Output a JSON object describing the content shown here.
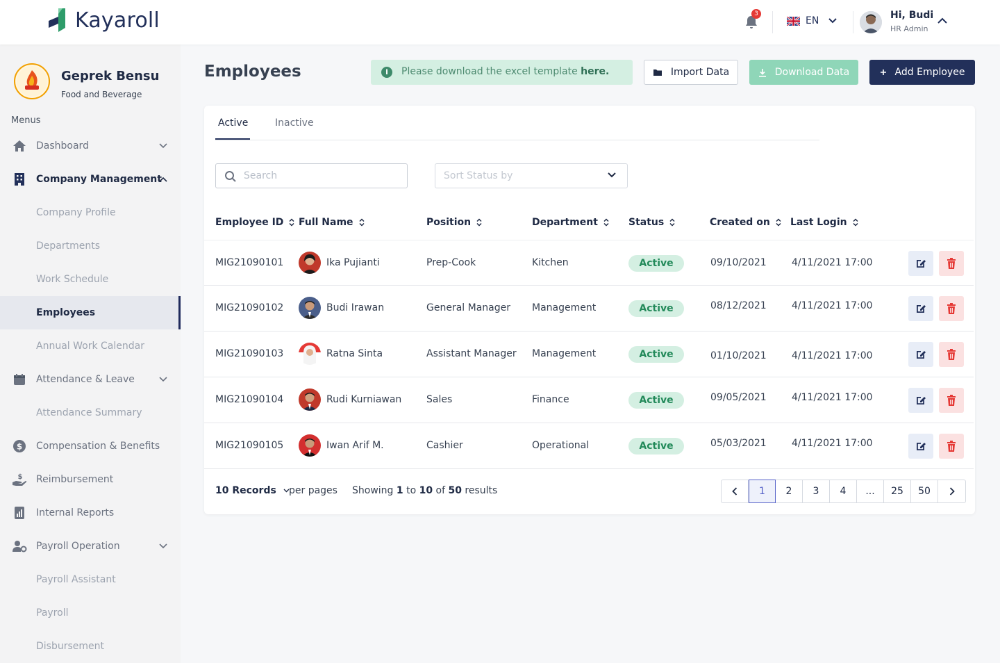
{
  "app": {
    "brand": "Kayaroll"
  },
  "header": {
    "notification_count": "3",
    "language": "EN",
    "user_greeting": "Hi, Budi",
    "user_role": "HR Admin"
  },
  "sidebar": {
    "company_name": "Geprek Bensu",
    "company_type": "Food and Beverage",
    "menus_label": "Menus",
    "items": [
      {
        "label": "Dashboard",
        "icon": "home-icon"
      },
      {
        "label": "Company Management",
        "icon": "building-icon"
      },
      {
        "label": "Company Profile"
      },
      {
        "label": "Departments"
      },
      {
        "label": "Work Schedule"
      },
      {
        "label": "Employees"
      },
      {
        "label": "Annual Work Calendar"
      },
      {
        "label": "Attendance & Leave",
        "icon": "calendar-icon"
      },
      {
        "label": "Attendance Summary"
      },
      {
        "label": "Compensation & Benefits",
        "icon": "dollar-icon"
      },
      {
        "label": "Reimbursement",
        "icon": "hand-money-icon"
      },
      {
        "label": "Internal Reports",
        "icon": "report-icon"
      },
      {
        "label": "Payroll Operation",
        "icon": "user-gear-icon"
      },
      {
        "label": "Payroll Assistant"
      },
      {
        "label": "Payroll"
      },
      {
        "label": "Disbursement"
      }
    ]
  },
  "main": {
    "title": "Employees",
    "banner_text": "Please download the excel template ",
    "banner_link": "here.",
    "import_label": "Import Data",
    "download_label": "Download Data",
    "add_label": "Add Employee",
    "tabs": [
      {
        "label": "Active"
      },
      {
        "label": "Inactive"
      }
    ],
    "search_placeholder": "Search",
    "sort_placeholder": "Sort Status by",
    "columns": [
      "Employee ID",
      "Full Name",
      "Position",
      "Department",
      "Status",
      "Created on",
      "Last Login"
    ],
    "rows": [
      {
        "id": "MIG21090101",
        "name": "Ika Pujianti",
        "position": "Prep-Cook",
        "department": "Kitchen",
        "status": "Active",
        "created": "09/10/2021",
        "last_login": "4/11/2021 17:00"
      },
      {
        "id": "MIG21090102",
        "name": "Budi Irawan",
        "position": "General Manager",
        "department": "Management",
        "status": "Active",
        "created": "08/12/2021",
        "last_login": "4/11/2021 17:00"
      },
      {
        "id": "MIG21090103",
        "name": "Ratna Sinta",
        "position": "Assistant Manager",
        "department": "Management",
        "status": "Active",
        "created": "01/10/2021",
        "last_login": "4/11/2021 17:00"
      },
      {
        "id": "MIG21090104",
        "name": "Rudi Kurniawan",
        "position": "Sales",
        "department": "Finance",
        "status": "Active",
        "created": "09/05/2021",
        "last_login": "4/11/2021 17:00"
      },
      {
        "id": "MIG21090105",
        "name": "Iwan Arif M.",
        "position": "Cashier",
        "department": "Operational",
        "status": "Active",
        "created": "05/03/2021",
        "last_login": "4/11/2021 17:00"
      }
    ],
    "footer": {
      "records": "10 Records",
      "per_pages": "per pages",
      "showing_prefix": "Showing ",
      "showing_from": "1",
      "showing_to_word": " to ",
      "showing_to": "10",
      "showing_of_word": " of ",
      "showing_total": "50",
      "showing_suffix": " results"
    },
    "pagination": [
      "1",
      "2",
      "3",
      "4",
      "...",
      "25",
      "50"
    ]
  },
  "colors": {
    "brand_navy": "#22305a",
    "brand_green": "#2e9c6a",
    "status_green_bg": "#d4efe2",
    "status_green_text": "#238a5a",
    "danger": "#e53935"
  }
}
